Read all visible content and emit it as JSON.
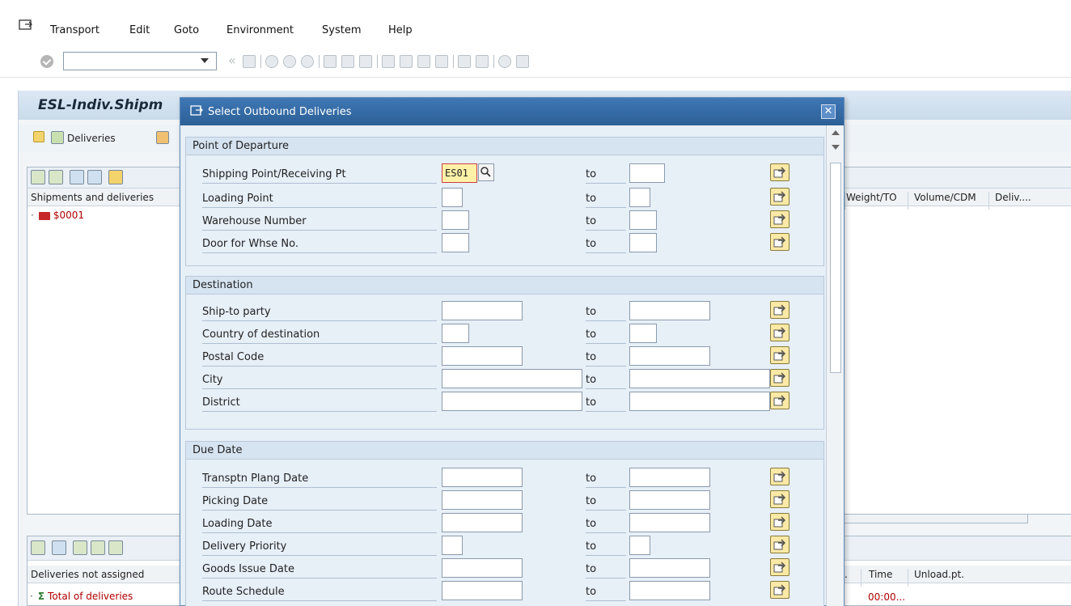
{
  "menu": {
    "items": [
      {
        "label": "Transport"
      },
      {
        "label": "Edit"
      },
      {
        "label": "Goto"
      },
      {
        "label": "Environment"
      },
      {
        "label": "System"
      },
      {
        "label": "Help"
      }
    ]
  },
  "toolbar": {
    "command_field_value": ""
  },
  "main": {
    "title": "ESL-Indiv.Shipm",
    "deliveries_button": "Deliveries",
    "tree_header_left": "Shipments and deliveries",
    "tree_header_cols": [
      "Weight/TO",
      "Volume/CDM",
      "Deliv...."
    ],
    "tree_rows": [
      {
        "label": "$0001"
      }
    ],
    "lower_header_left": "Deliveries not assigned",
    "lower_header_cols": [
      ".",
      "Time",
      "Unload.pt."
    ],
    "lower_rows": [
      {
        "label": "Total of deliveries",
        "time": "00:00..."
      }
    ]
  },
  "dialog": {
    "title": "Select Outbound Deliveries",
    "to_label": "to",
    "sections": [
      {
        "heading": "Point of Departure",
        "fields": [
          {
            "label": "Shipping Point/Receiving Pt",
            "from": "ES01"
          },
          {
            "label": "Loading Point",
            "from": ""
          },
          {
            "label": "Warehouse Number",
            "from": ""
          },
          {
            "label": "Door for Whse No.",
            "from": ""
          }
        ]
      },
      {
        "heading": "Destination",
        "fields": [
          {
            "label": "Ship-to party",
            "from": ""
          },
          {
            "label": "Country of destination",
            "from": ""
          },
          {
            "label": "Postal Code",
            "from": ""
          },
          {
            "label": "City",
            "from": ""
          },
          {
            "label": "District",
            "from": ""
          }
        ]
      },
      {
        "heading": "Due Date",
        "fields": [
          {
            "label": "Transptn Plang Date",
            "from": ""
          },
          {
            "label": "Picking Date",
            "from": ""
          },
          {
            "label": "Loading Date",
            "from": ""
          },
          {
            "label": "Delivery Priority",
            "from": ""
          },
          {
            "label": "Goods Issue Date",
            "from": ""
          },
          {
            "label": "Route Schedule",
            "from": ""
          }
        ]
      }
    ]
  }
}
